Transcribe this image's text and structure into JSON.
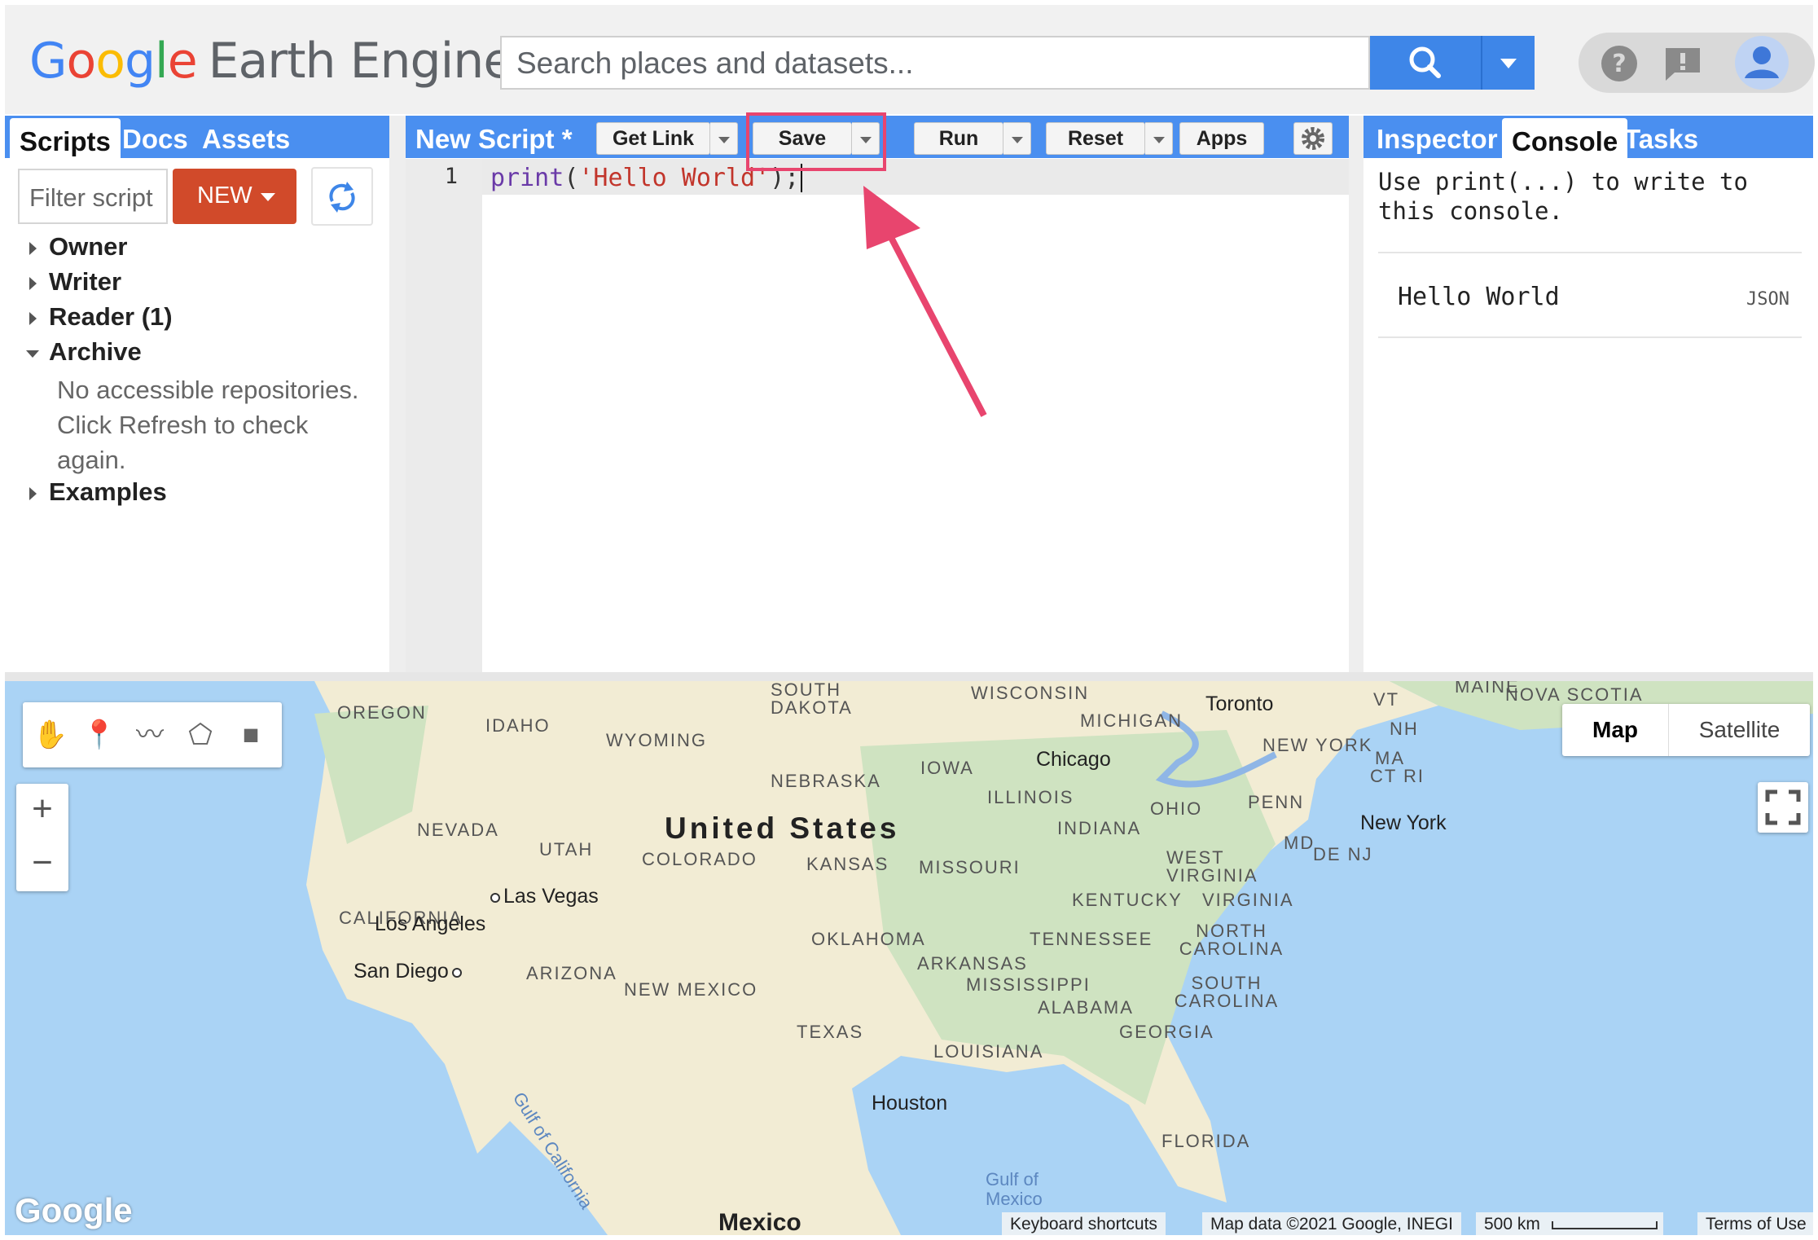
{
  "app": {
    "logo_parts": [
      "G",
      "o",
      "o",
      "g",
      "l",
      "e"
    ],
    "logo_product": "Earth Engine",
    "search_placeholder": "Search places and datasets..."
  },
  "left_panel": {
    "tabs": [
      "Scripts",
      "Docs",
      "Assets"
    ],
    "active_tab": "Scripts",
    "filter_placeholder": "Filter script",
    "new_label": "NEW",
    "tree": [
      {
        "label": "Owner",
        "open": false
      },
      {
        "label": "Writer",
        "open": false
      },
      {
        "label": "Reader (1)",
        "open": false
      },
      {
        "label": "Archive",
        "open": true
      }
    ],
    "archive_message": [
      "No accessible repositories.",
      "Click Refresh to check",
      "again."
    ],
    "examples_label": "Examples"
  },
  "editor": {
    "script_title": "New Script *",
    "buttons": {
      "get_link": "Get Link",
      "save": "Save",
      "run": "Run",
      "reset": "Reset",
      "apps": "Apps"
    },
    "line_number": "1",
    "code": {
      "fn": "print",
      "open": "(",
      "str": "'Hello World'",
      "close": ");"
    }
  },
  "right_panel": {
    "tabs": [
      "Inspector",
      "Console",
      "Tasks"
    ],
    "active_tab": "Console",
    "info": "Use print(...) to write to this console.",
    "output": "Hello World",
    "output_type": "JSON"
  },
  "map": {
    "types": [
      "Map",
      "Satellite"
    ],
    "active_type": "Map",
    "country_label": "United States",
    "states": [
      "OREGON",
      "IDAHO",
      "WYOMING",
      "SOUTH DAKOTA",
      "WISCONSIN",
      "MICHIGAN",
      "NEBRASKA",
      "IOWA",
      "ILLINOIS",
      "OHIO",
      "PENN",
      "NEVADA",
      "UTAH",
      "COLORADO",
      "KANSAS",
      "MISSOURI",
      "INDIANA",
      "WEST VIRGINIA",
      "KENTUCKY",
      "VIRGINIA",
      "CALIFORNIA",
      "OKLAHOMA",
      "TENNESSEE",
      "NORTH CAROLINA",
      "ARIZONA",
      "NEW MEXICO",
      "ARKANSAS",
      "MISSISSIPPI",
      "SOUTH CAROLINA",
      "ALABAMA",
      "GEORGIA",
      "TEXAS",
      "LOUISIANA",
      "FLORIDA",
      "NEW YORK",
      "VT",
      "NH",
      "MA",
      "CT RI",
      "MD",
      "DE NJ",
      "MAINE",
      "NOVA SCOTIA",
      "Gulf of California",
      "Gulf of Mexico"
    ],
    "cities": [
      "Toronto",
      "Chicago",
      "New York",
      "Las Vegas",
      "Los Angeles",
      "San Diego",
      "Houston",
      "Mexico"
    ],
    "footer": {
      "google": "Google",
      "shortcuts": "Keyboard shortcuts",
      "data": "Map data ©2021 Google, INEGI",
      "scale": "500 km",
      "terms": "Terms of Use"
    },
    "zoom_in": "+",
    "zoom_out": "−"
  },
  "colors": {
    "accent": "#4a8ff0",
    "new_button": "#d14a2a",
    "highlight": "#e8456e",
    "map_land": "#f2ecd4",
    "map_water": "#aad3f5"
  }
}
